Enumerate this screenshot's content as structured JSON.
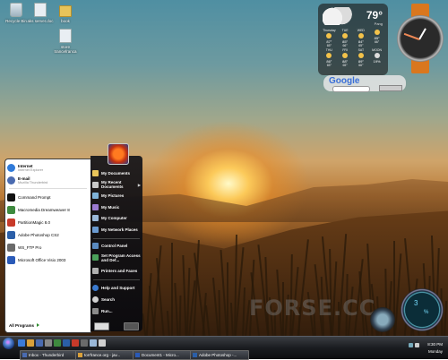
{
  "desktop": {
    "icons": [
      {
        "label": "Recycle Bin",
        "icon": "recycle-bin-icon",
        "kind": "bin"
      },
      {
        "label": "aks server.doc",
        "icon": "document-icon",
        "kind": "doc"
      },
      {
        "label": "book",
        "icon": "folder-icon",
        "kind": "folder"
      },
      {
        "label": "store trancefranca",
        "icon": "document-icon",
        "kind": "doc"
      }
    ]
  },
  "weather_widget": {
    "temperature": "79°",
    "location": "Pang",
    "days": [
      {
        "day": "Thursday",
        "hi": "87°",
        "lo": "65°"
      },
      {
        "day": "TUE",
        "hi": "85°",
        "lo": "66°"
      },
      {
        "day": "WED",
        "hi": "84°",
        "lo": "65°"
      },
      {
        "day": "",
        "hi": "85°",
        "lo": "66°"
      },
      {
        "day": "THU",
        "hi": "86°",
        "lo": "65°"
      },
      {
        "day": "FRI",
        "hi": "88°",
        "lo": "65°"
      },
      {
        "day": "SAT",
        "hi": "89°",
        "lo": "66°"
      },
      {
        "day": "MOON",
        "hi": "19%",
        "lo": ""
      }
    ]
  },
  "clock_widget": {
    "icon": "analog-clock-icon"
  },
  "google_gadget": {
    "logo": "Google"
  },
  "watermark": "FORSE.CC",
  "cpu_gauge": {
    "value": "3",
    "unit": "%"
  },
  "start_menu": {
    "pinned": [
      {
        "label": "Internet",
        "sub": "Internet Explorer",
        "icon": "internet-explorer-icon",
        "color": "#2f7ad9"
      },
      {
        "label": "E-mail",
        "sub": "Mozilla Thunderbird",
        "icon": "thunderbird-icon",
        "color": "#4a6bb0"
      }
    ],
    "recent": [
      {
        "label": "Command Prompt",
        "icon": "command-prompt-icon",
        "color": "#111111"
      },
      {
        "label": "Macromedia Dreamweaver 8",
        "icon": "dreamweaver-icon",
        "color": "#3e8a3e"
      },
      {
        "label": "PartitionMagic 8.0",
        "icon": "partition-magic-icon",
        "color": "#c83a2a"
      },
      {
        "label": "Adobe Photoshop CS2",
        "icon": "photoshop-icon",
        "color": "#2b5fa8"
      },
      {
        "label": "WS_FTP Pro",
        "icon": "ftp-icon",
        "color": "#6a6a6a"
      },
      {
        "label": "Microsoft Office Visio 2003",
        "icon": "visio-icon",
        "color": "#2a5ab8"
      }
    ],
    "all_programs": "All Programs",
    "right": [
      {
        "label": "My Documents",
        "icon": "my-documents-icon",
        "chevron": false
      },
      {
        "label": "My Recent Documents",
        "icon": "recent-documents-icon",
        "chevron": true
      },
      {
        "label": "My Pictures",
        "icon": "my-pictures-icon",
        "chevron": false
      },
      {
        "label": "My Music",
        "icon": "my-music-icon",
        "chevron": false
      },
      {
        "label": "My Computer",
        "icon": "my-computer-icon",
        "chevron": false
      },
      {
        "label": "My Network Places",
        "icon": "network-places-icon",
        "chevron": false
      },
      {
        "label": "Control Panel",
        "icon": "control-panel-icon",
        "chevron": false
      },
      {
        "label": "Set Program Access and Def...",
        "icon": "program-access-icon",
        "chevron": false
      },
      {
        "label": "Printers and Faxes",
        "icon": "printers-icon",
        "chevron": false
      },
      {
        "label": "Help and Support",
        "icon": "help-icon",
        "chevron": false
      },
      {
        "label": "Search",
        "icon": "search-icon",
        "chevron": false
      },
      {
        "label": "Run...",
        "icon": "run-icon",
        "chevron": false
      }
    ]
  },
  "taskbar": {
    "tasks": [
      {
        "label": "Inbox - Thunderbird",
        "icon": "thunderbird-icon"
      },
      {
        "label": "torrfrance.org - jav...",
        "icon": "browser-icon"
      },
      {
        "label": "Document1 - Micro...",
        "icon": "word-icon"
      },
      {
        "label": "Adobe Photoshop -...",
        "icon": "photoshop-icon"
      }
    ],
    "time": "8:30 PM",
    "day": "Monday"
  }
}
